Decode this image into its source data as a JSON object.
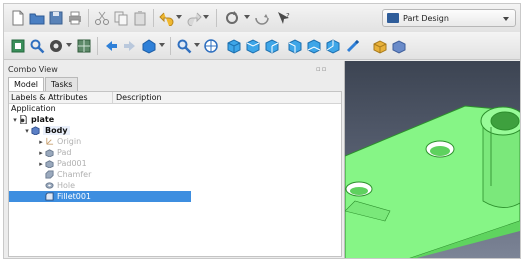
{
  "workbench": {
    "label": "Part Design"
  },
  "combo_view": {
    "title": "Combo View",
    "tabs": [
      {
        "label": "Model"
      },
      {
        "label": "Tasks"
      }
    ]
  },
  "tree": {
    "columns": {
      "labels": "Labels & Attributes",
      "description": "Description"
    },
    "application_label": "Application",
    "items": [
      {
        "label": "plate"
      },
      {
        "label": "Body"
      },
      {
        "label": "Origin"
      },
      {
        "label": "Pad"
      },
      {
        "label": "Pad001"
      },
      {
        "label": "Chamfer"
      },
      {
        "label": "Hole"
      },
      {
        "label": "Fillet001"
      }
    ]
  },
  "colors": {
    "selection": "#3d8ee0",
    "solid_green": "#7cf07c",
    "viewport_top": "#3c4452",
    "viewport_bottom": "#7d8597"
  }
}
